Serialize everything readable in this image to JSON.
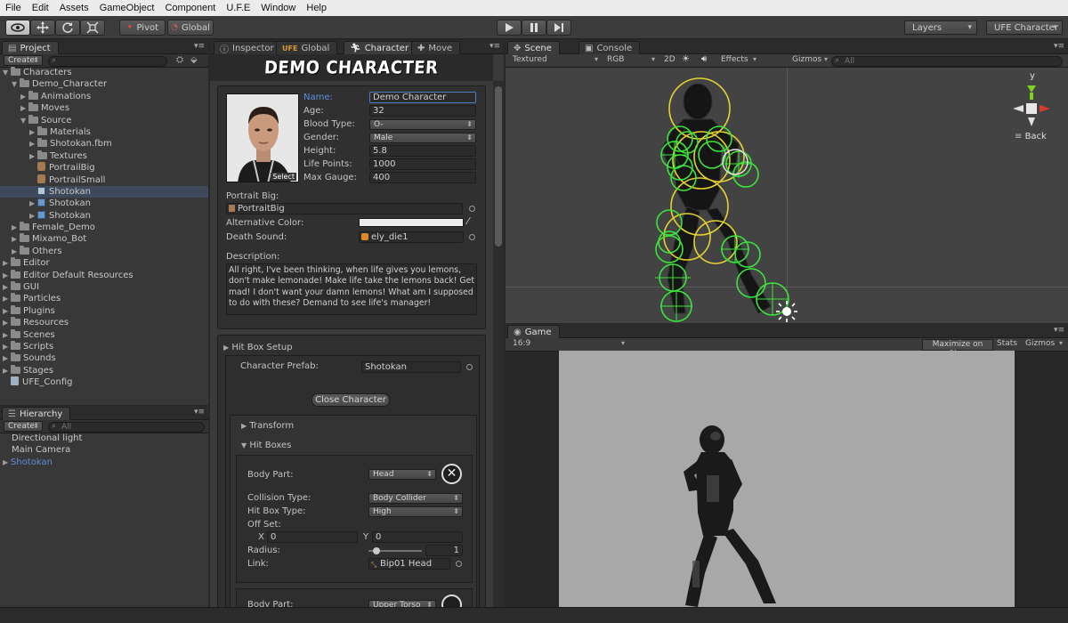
{
  "menu": [
    "File",
    "Edit",
    "Assets",
    "GameObject",
    "Component",
    "U.F.E",
    "Window",
    "Help"
  ],
  "toolbar": {
    "pivot": "Pivot",
    "global": "Global",
    "layers": "Layers",
    "layout": "UFE Character"
  },
  "project": {
    "tab": "Project",
    "create": "Create",
    "items": [
      {
        "label": "Characters",
        "depth": 0,
        "type": "folder",
        "open": true
      },
      {
        "label": "Demo_Character",
        "depth": 1,
        "type": "folder",
        "open": true
      },
      {
        "label": "Animations",
        "depth": 2,
        "type": "folder",
        "open": false
      },
      {
        "label": "Moves",
        "depth": 2,
        "type": "folder",
        "open": false
      },
      {
        "label": "Source",
        "depth": 2,
        "type": "folder",
        "open": true
      },
      {
        "label": "Materials",
        "depth": 3,
        "type": "folder",
        "open": false
      },
      {
        "label": "Shotokan.fbm",
        "depth": 3,
        "type": "folder",
        "open": false
      },
      {
        "label": "Textures",
        "depth": 3,
        "type": "folder",
        "open": false
      },
      {
        "label": "PortrailBig",
        "depth": 3,
        "type": "image"
      },
      {
        "label": "PortrailSmall",
        "depth": 3,
        "type": "image"
      },
      {
        "label": "Shotokan",
        "depth": 3,
        "type": "prefab-grey",
        "selected": true
      },
      {
        "label": "Shotokan",
        "depth": 3,
        "type": "prefab",
        "open": false
      },
      {
        "label": "Shotokan",
        "depth": 3,
        "type": "prefab",
        "open": false
      },
      {
        "label": "Female_Demo",
        "depth": 1,
        "type": "folder",
        "open": false
      },
      {
        "label": "Mixamo_Bot",
        "depth": 1,
        "type": "folder",
        "open": false
      },
      {
        "label": "Others",
        "depth": 1,
        "type": "folder",
        "open": false
      },
      {
        "label": "Editor",
        "depth": 0,
        "type": "folder",
        "open": false
      },
      {
        "label": "Editor Default Resources",
        "depth": 0,
        "type": "folder",
        "open": false
      },
      {
        "label": "GUI",
        "depth": 0,
        "type": "folder",
        "open": false
      },
      {
        "label": "Particles",
        "depth": 0,
        "type": "folder",
        "open": false
      },
      {
        "label": "Plugins",
        "depth": 0,
        "type": "folder",
        "open": false
      },
      {
        "label": "Resources",
        "depth": 0,
        "type": "folder",
        "open": false
      },
      {
        "label": "Scenes",
        "depth": 0,
        "type": "folder",
        "open": false
      },
      {
        "label": "Scripts",
        "depth": 0,
        "type": "folder",
        "open": false
      },
      {
        "label": "Sounds",
        "depth": 0,
        "type": "folder",
        "open": false
      },
      {
        "label": "Stages",
        "depth": 0,
        "type": "folder",
        "open": false
      },
      {
        "label": "UFE_Config",
        "depth": 0,
        "type": "config"
      }
    ]
  },
  "hierarchy": {
    "tab": "Hierarchy",
    "create": "Create",
    "search": "All",
    "items": [
      "Directional light",
      "Main Camera",
      "Shotokan"
    ]
  },
  "inspector_tabs": [
    "Inspector",
    "Global",
    "Character",
    "Move"
  ],
  "character": {
    "header": "DEMO CHARACTER",
    "select": "Select",
    "name_label": "Name:",
    "name": "Demo Character",
    "age_label": "Age:",
    "age": "32",
    "blood_label": "Blood Type:",
    "blood": "O-",
    "gender_label": "Gender:",
    "gender": "Male",
    "height_label": "Height:",
    "height": "5.8",
    "life_label": "Life Points:",
    "life": "1000",
    "gauge_label": "Max Gauge:",
    "gauge": "400",
    "portrait_label": "Portrait Big:",
    "portrait": "PortraitBig",
    "altcolor_label": "Alternative Color:",
    "death_label": "Death Sound:",
    "death": "ely_die1",
    "desc_label": "Description:",
    "description": "All right, I've been thinking, when life gives you lemons, don't make lemonade! Make life take the lemons back! Get mad! I don't want your damn lemons! What am I supposed to do with these? Demand to see life's manager!",
    "hitbox_setup": "Hit Box Setup",
    "prefab_label": "Character Prefab:",
    "prefab": "Shotokan",
    "close_button": "Close Character",
    "transform": "Transform",
    "hitboxes": "Hit Boxes",
    "bodypart_label": "Body Part:",
    "bodypart": "Head",
    "collision_label": "Collision Type:",
    "collision": "Body Collider",
    "hitboxtype_label": "Hit Box Type:",
    "hitboxtype": "High",
    "offset_label": "Off Set:",
    "x_label": "X",
    "x": "0",
    "y_label": "Y",
    "y": "0",
    "radius_label": "Radius:",
    "radius": "1",
    "radius_fraction": 0.15,
    "link_label": "Link:",
    "link": "Bip01 Head",
    "bodypart2_label": "Body Part:",
    "bodypart2": "Upper Torso"
  },
  "scene": {
    "tab": "Scene",
    "console_tab": "Console",
    "textured": "Textured",
    "rgb": "RGB",
    "mode2d": "2D",
    "effects": "Effects",
    "gizmos": "Gizmos",
    "search": "All",
    "back": "Back",
    "y_axis": "y"
  },
  "game": {
    "tab": "Game",
    "aspect": "16:9",
    "maximize": "Maximize on Play",
    "stats": "Stats",
    "gizmos": "Gizmos"
  },
  "colors": {
    "accent_blue": "#4f8fe0",
    "hitbox_green": "#3be43b",
    "hitbox_yellow": "#e3d130",
    "game_bg": "#a8a8a8"
  }
}
